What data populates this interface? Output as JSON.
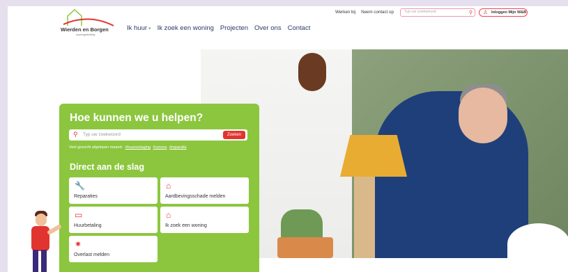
{
  "logo": {
    "name": "Wierden en Borgen",
    "subtitle": "woningstichting"
  },
  "nav": {
    "items": [
      "Ik huur",
      "Ik zoek een woning",
      "Projecten",
      "Over ons",
      "Contact"
    ]
  },
  "toplinks": {
    "werken_bij": "Werken bij",
    "contact": "Neem contact op"
  },
  "top_search": {
    "placeholder": "Typ uw zoekwoord"
  },
  "login": {
    "label": "Inloggen Mijn W&B"
  },
  "help": {
    "title": "Hoe kunnen we u helpen?",
    "search_placeholder": "Typ uw zoekwoord",
    "search_button": "Zoeken",
    "popular_prefix": "Veel gezocht afgelopen maand:",
    "popular_tags": [
      "#huurverlaging",
      "#corona",
      "#reparatie"
    ]
  },
  "direct": {
    "title": "Direct aan de slag",
    "tiles": [
      {
        "label": "Reparaties",
        "icon": "wrench-icon"
      },
      {
        "label": "Aardbevingsschade melden",
        "icon": "house-crack-icon"
      },
      {
        "label": "Huurbetaling",
        "icon": "money-icon"
      },
      {
        "label": "Ik zoek een woning",
        "icon": "home-search-icon"
      },
      {
        "label": "Overlast melden",
        "icon": "nuisance-icon"
      }
    ]
  },
  "colors": {
    "brand_green": "#8cc63f",
    "accent_red": "#e2342f",
    "nav_blue": "#2b3a67"
  }
}
